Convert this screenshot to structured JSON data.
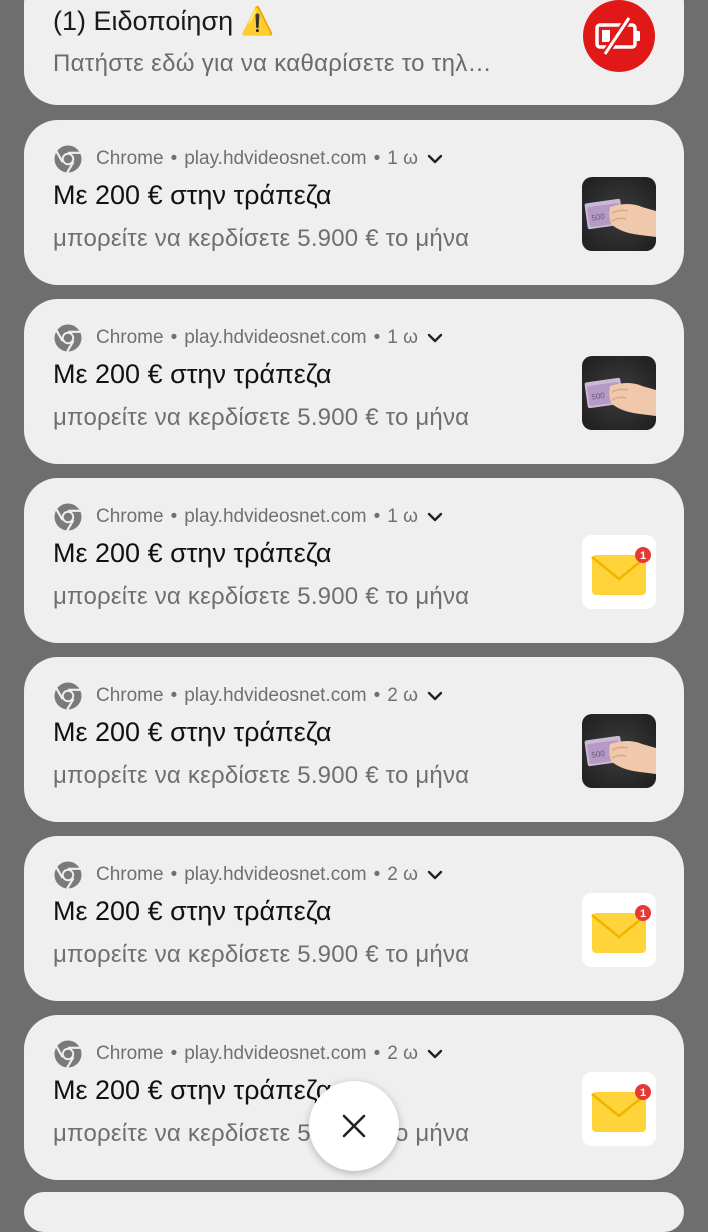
{
  "top_notification": {
    "title": "(1) Ειδοποίηση ⚠️",
    "subtitle": "Πατήστε εδώ για να καθαρίσετε το τηλ…",
    "icon": "battery-crossed-icon",
    "icon_bg": "#e01818"
  },
  "notifications": [
    {
      "app": "Chrome",
      "site": "play.hdvideosnet.com",
      "time": "1 ω",
      "title": "Με 200 € στην τράπεζα",
      "body": "μπορείτε να κερδίσετε 5.900 € το μήνα",
      "thumbnail": "money-hand-image"
    },
    {
      "app": "Chrome",
      "site": "play.hdvideosnet.com",
      "time": "1 ω",
      "title": "Με 200 € στην τράπεζα",
      "body": "μπορείτε να κερδίσετε 5.900 € το μήνα",
      "thumbnail": "money-hand-image"
    },
    {
      "app": "Chrome",
      "site": "play.hdvideosnet.com",
      "time": "1 ω",
      "title": "Με 200 € στην τράπεζα",
      "body": "μπορείτε να κερδίσετε 5.900 € το μήνα",
      "thumbnail": "mail-envelope-icon",
      "thumbnail_badge": "1"
    },
    {
      "app": "Chrome",
      "site": "play.hdvideosnet.com",
      "time": "2 ω",
      "title": "Με 200 € στην τράπεζα",
      "body": "μπορείτε να κερδίσετε 5.900 € το μήνα",
      "thumbnail": "money-hand-image"
    },
    {
      "app": "Chrome",
      "site": "play.hdvideosnet.com",
      "time": "2 ω",
      "title": "Με 200 € στην τράπεζα",
      "body": "μπορείτε να κερδίσετε 5.900 € το μήνα",
      "thumbnail": "mail-envelope-icon",
      "thumbnail_badge": "1"
    },
    {
      "app": "Chrome",
      "site": "play.hdvideosnet.com",
      "time": "2 ω",
      "title": "Με 200 € στην τράπεζα",
      "body": "μπορείτε να κερδίσετε 5.900 € το μήνα",
      "thumbnail": "mail-envelope-icon",
      "thumbnail_badge": "1"
    }
  ],
  "close_button": {
    "icon": "close-icon"
  },
  "colors": {
    "backdrop": "#6e6e6e",
    "card": "#efefef",
    "badge": "#e53935",
    "envelope": "#ffd43b"
  }
}
